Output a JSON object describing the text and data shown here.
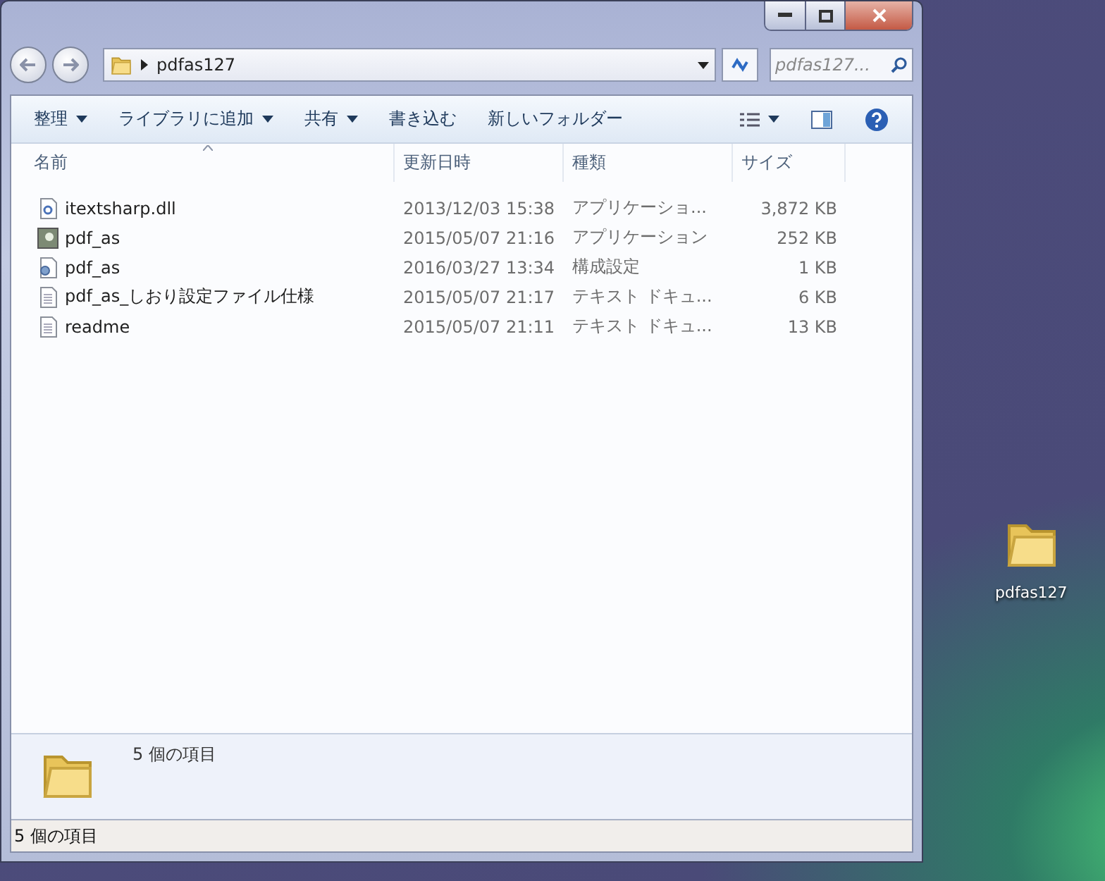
{
  "window": {
    "address": "pdfas127",
    "search": {
      "placeholder": "pdfas127..."
    }
  },
  "toolbar": [
    {
      "label": "整理",
      "dropdown": true
    },
    {
      "label": "ライブラリに追加",
      "dropdown": true
    },
    {
      "label": "共有",
      "dropdown": true
    },
    {
      "label": "書き込む",
      "dropdown": false
    },
    {
      "label": "新しいフォルダー",
      "dropdown": false
    }
  ],
  "columns": [
    "名前",
    "更新日時",
    "種類",
    "サイズ"
  ],
  "files": [
    {
      "kind": "dll",
      "name": "itextsharp.dll",
      "modified": "2013/12/03 15:38",
      "type": "アプリケーショ...",
      "size": "3,872 KB"
    },
    {
      "kind": "app",
      "name": "pdf_as",
      "modified": "2015/05/07 21:16",
      "type": "アプリケーション",
      "size": "252 KB"
    },
    {
      "kind": "config",
      "name": "pdf_as",
      "modified": "2016/03/27 13:34",
      "type": "構成設定",
      "size": "1 KB"
    },
    {
      "kind": "text",
      "name": "pdf_as_しおり設定ファイル仕様",
      "modified": "2015/05/07 21:17",
      "type": "テキスト ドキュ...",
      "size": "6 KB"
    },
    {
      "kind": "text",
      "name": "readme",
      "modified": "2015/05/07 21:11",
      "type": "テキスト ドキュ...",
      "size": "13 KB"
    }
  ],
  "details": {
    "count": "5 個の項目"
  },
  "status_bar": "5 個の項目",
  "desktop_icon": {
    "label": "pdfas127"
  }
}
